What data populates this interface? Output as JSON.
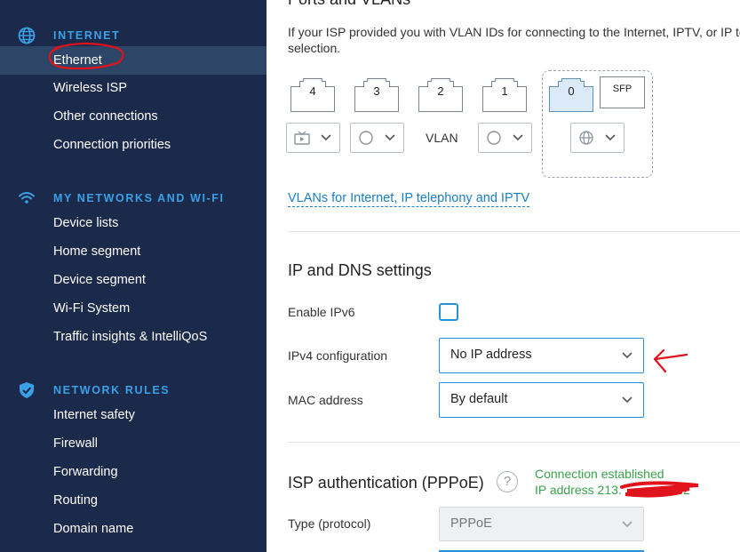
{
  "sidebar": {
    "sections": [
      {
        "title": "INTERNET",
        "icon": "globe-icon",
        "items": [
          "Ethernet",
          "Wireless ISP",
          "Other connections",
          "Connection priorities"
        ]
      },
      {
        "title": "MY NETWORKS AND WI-FI",
        "icon": "wifi-icon",
        "items": [
          "Device lists",
          "Home segment",
          "Device segment",
          "Wi-Fi System",
          "Traffic insights & IntelliQoS"
        ]
      },
      {
        "title": "NETWORK RULES",
        "icon": "shield-icon",
        "items": [
          "Internet safety",
          "Firewall",
          "Forwarding",
          "Routing",
          "Domain name"
        ]
      }
    ],
    "active_item": "Ethernet"
  },
  "ports": {
    "title": "Ports and VLANs",
    "description_line1": "If your ISP provided you with VLAN IDs for connecting to the Internet, IPTV, or IP te",
    "description_line2": "selection.",
    "port_labels": [
      "4",
      "3",
      "2",
      "1",
      "0"
    ],
    "sfp_label": "SFP",
    "vlan_label": "VLAN",
    "vlan_link": "VLANs for Internet, IP telephony and IPTV"
  },
  "ip_dns": {
    "title": "IP and DNS settings",
    "enable_ipv6_label": "Enable IPv6",
    "ipv6_enabled": false,
    "ipv4_label": "IPv4 configuration",
    "ipv4_value": "No IP address",
    "mac_label": "MAC address",
    "mac_value": "By default"
  },
  "isp_auth": {
    "title": "ISP authentication (PPPoE)",
    "help_symbol": "?",
    "status_line1": "Connection established",
    "status_line2": "IP address 213.",
    "status_line2_end": "2",
    "type_label": "Type (protocol)",
    "type_value": "PPPoE"
  },
  "colors": {
    "sidebar_bg": "#1b2a4a",
    "sidebar_active": "#2d4566",
    "accent": "#2a8fd6",
    "link": "#1b7fc9",
    "success": "#3aa24a",
    "annotation": "#e0121b"
  }
}
